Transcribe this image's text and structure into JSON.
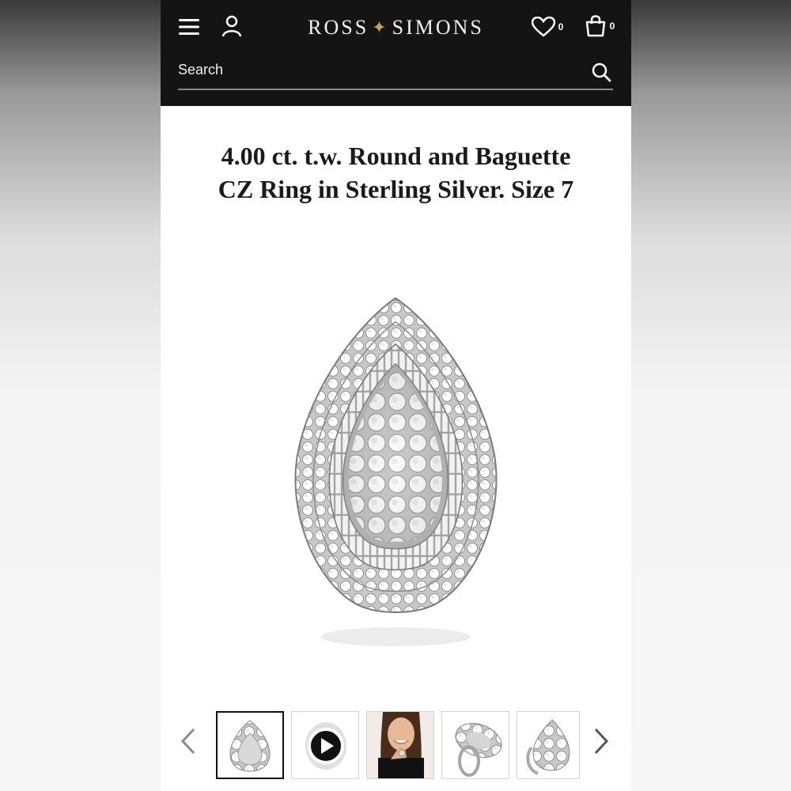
{
  "header": {
    "brand": {
      "first": "ROSS",
      "second": "SIMONS"
    },
    "wishlist_count": "0",
    "bag_count": "0",
    "search_placeholder": "Search"
  },
  "product": {
    "title_line1": "4.00 ct. t.w. Round and Baguette",
    "title_line2": "CZ Ring in Sterling Silver. Size 7"
  },
  "gallery": {
    "thumbnails": [
      "ring-front",
      "video",
      "model-wearing",
      "ring-angle",
      "ring-side"
    ],
    "selected_index": 0
  },
  "icons": [
    "hamburger-menu-icon",
    "account-icon",
    "heart-icon",
    "shopping-bag-icon",
    "search-icon",
    "play-icon",
    "chevron-left-icon",
    "chevron-right-icon"
  ],
  "colors": {
    "header_bg": "#141414",
    "accent_star": "#c9a24a"
  }
}
